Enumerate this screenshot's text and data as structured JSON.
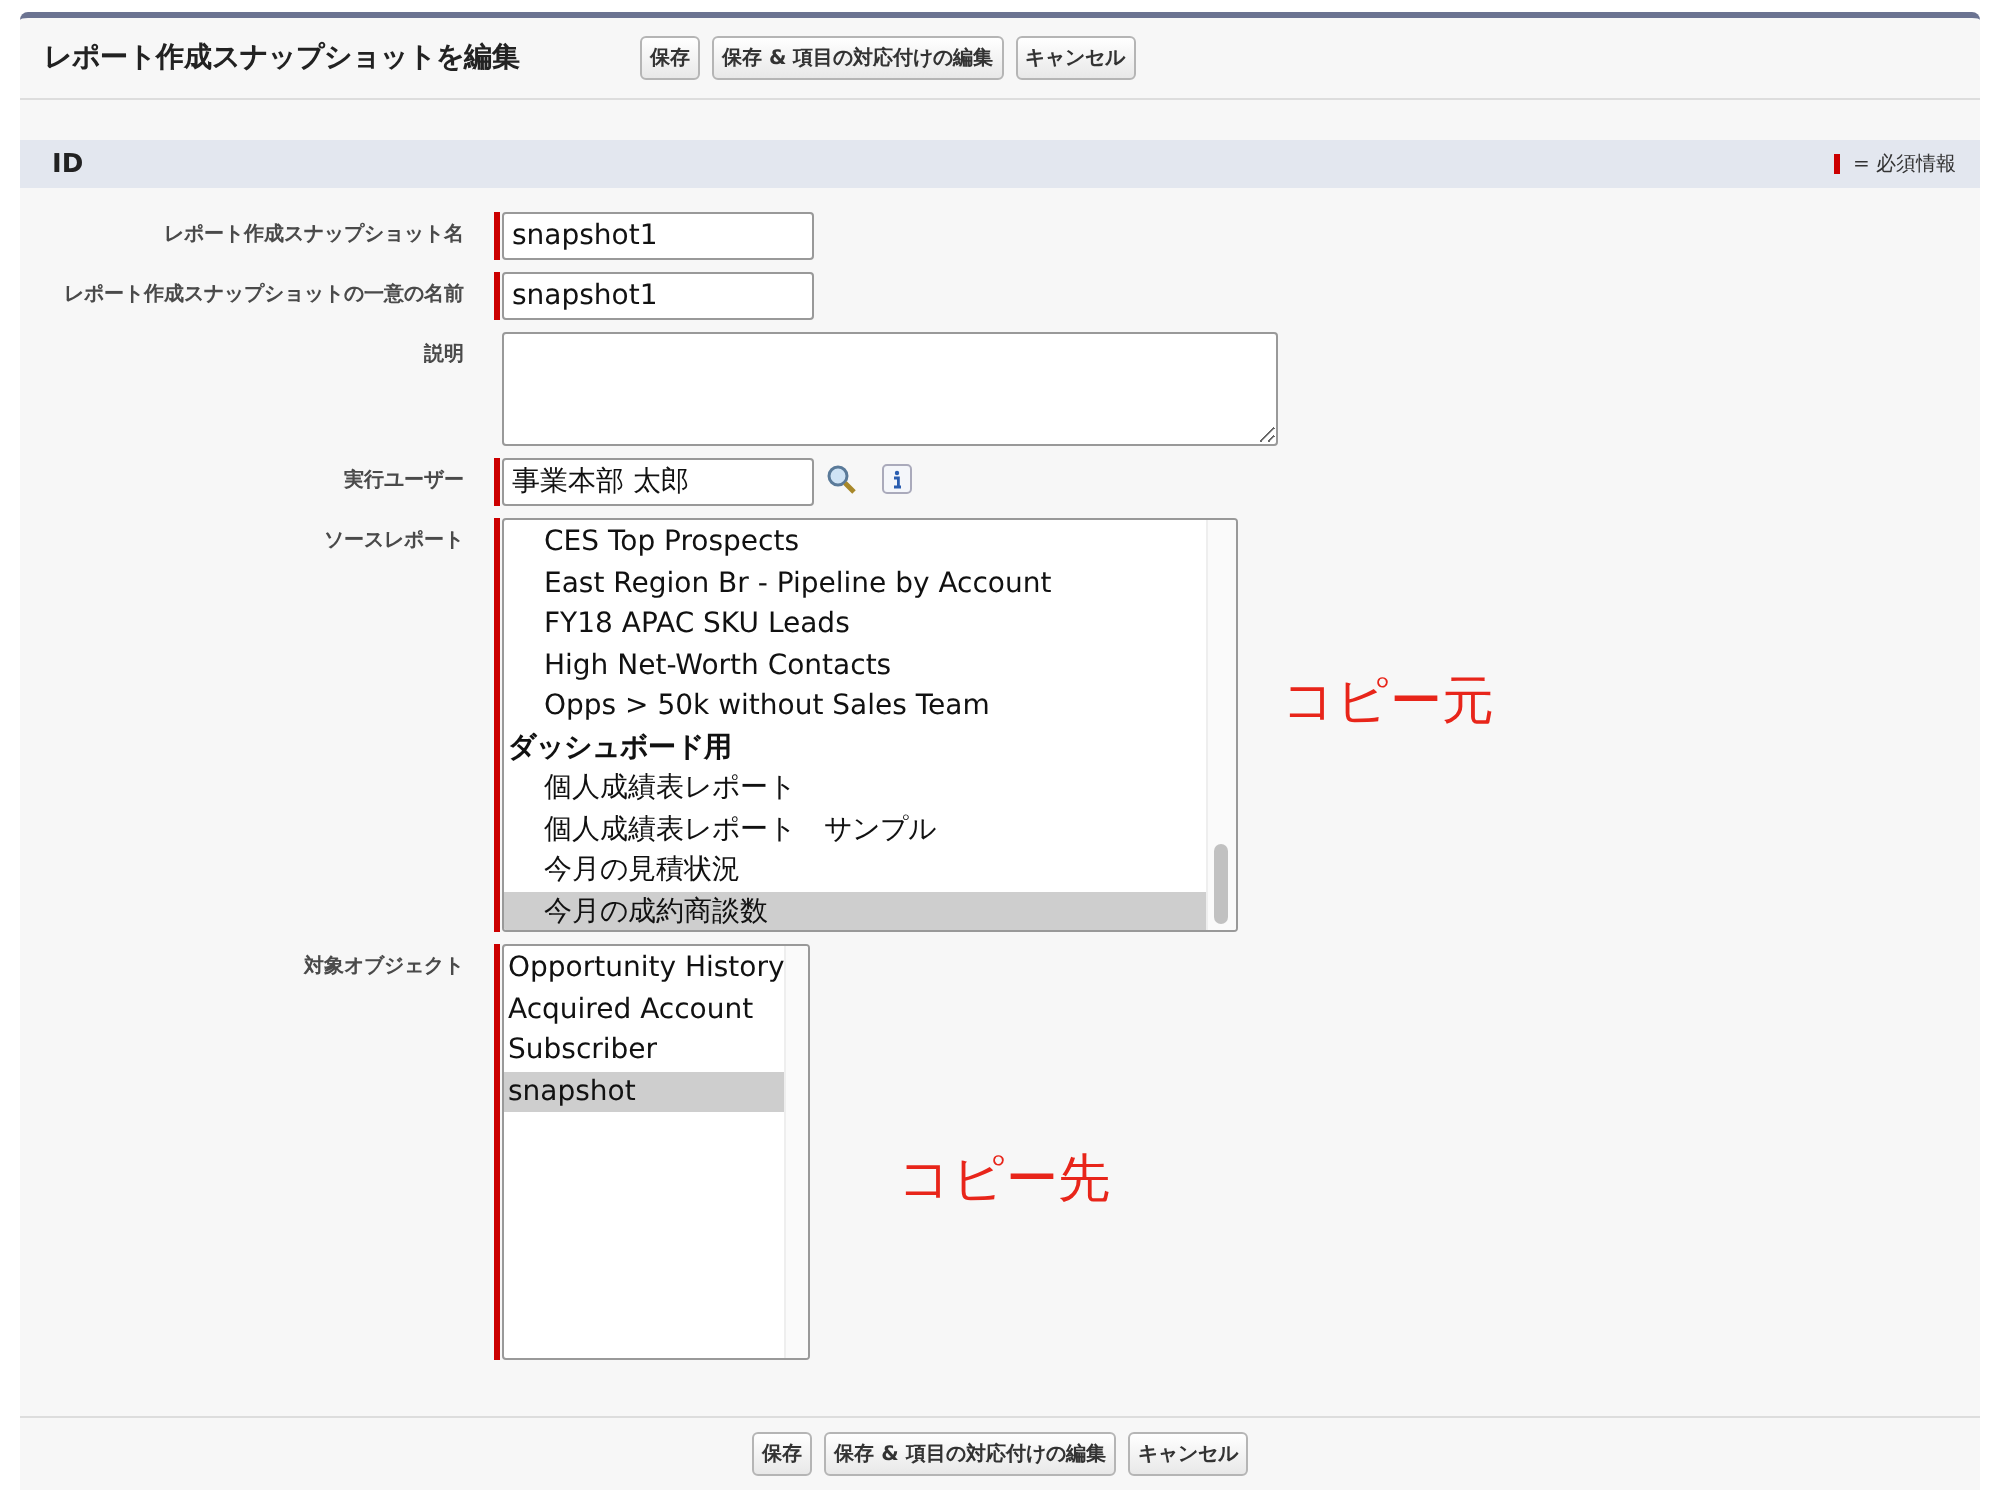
{
  "header": {
    "title": "レポート作成スナップショットを編集",
    "buttons": [
      "保存",
      "保存 & 項目の対応付けの編集",
      "キャンセル"
    ]
  },
  "section": {
    "title": "ID",
    "required_legend": "= 必須情報"
  },
  "fields": [
    {
      "kind": "text",
      "label": "レポート作成スナップショット名",
      "required": true,
      "value": "snapshot1"
    },
    {
      "kind": "text",
      "label": "レポート作成スナップショットの一意の名前",
      "required": true,
      "value": "snapshot1"
    },
    {
      "kind": "textarea",
      "label": "説明",
      "required": false
    },
    {
      "kind": "lookup",
      "label": "実行ユーザー",
      "required": true,
      "value": "事業本部 太郎"
    },
    {
      "kind": "listbox",
      "label": "ソースレポート",
      "required": true,
      "annotation": "コピー元",
      "options": [
        {
          "kind": "option",
          "text": "CES Top Prospects",
          "selected": false
        },
        {
          "kind": "option",
          "text": "East Region Br - Pipeline by Account",
          "selected": false
        },
        {
          "kind": "option",
          "text": "FY18 APAC SKU Leads",
          "selected": false
        },
        {
          "kind": "option",
          "text": "High Net-Worth Contacts",
          "selected": false
        },
        {
          "kind": "option",
          "text": "Opps > 50k without Sales Team",
          "selected": false
        },
        {
          "kind": "group",
          "text": "ダッシュボード用",
          "selected": false
        },
        {
          "kind": "option",
          "text": "個人成績表レポート",
          "selected": false
        },
        {
          "kind": "option",
          "text": "個人成績表レポート　サンプル",
          "selected": false
        },
        {
          "kind": "option",
          "text": "今月の見積状況",
          "selected": false
        },
        {
          "kind": "option",
          "text": "今月の成約商談数",
          "selected": true
        }
      ]
    },
    {
      "kind": "listbox",
      "label": "対象オブジェクト",
      "required": true,
      "annotation": "コピー先",
      "options": [
        {
          "kind": "option",
          "text": "Opportunity History",
          "selected": false
        },
        {
          "kind": "option",
          "text": "Acquired Account",
          "selected": false
        },
        {
          "kind": "option",
          "text": "Subscriber",
          "selected": false
        },
        {
          "kind": "option",
          "text": "snapshot",
          "selected": true
        }
      ]
    }
  ],
  "footer": {
    "buttons": [
      "保存",
      "保存 & 項目の対応付けの編集",
      "キャンセル"
    ]
  }
}
